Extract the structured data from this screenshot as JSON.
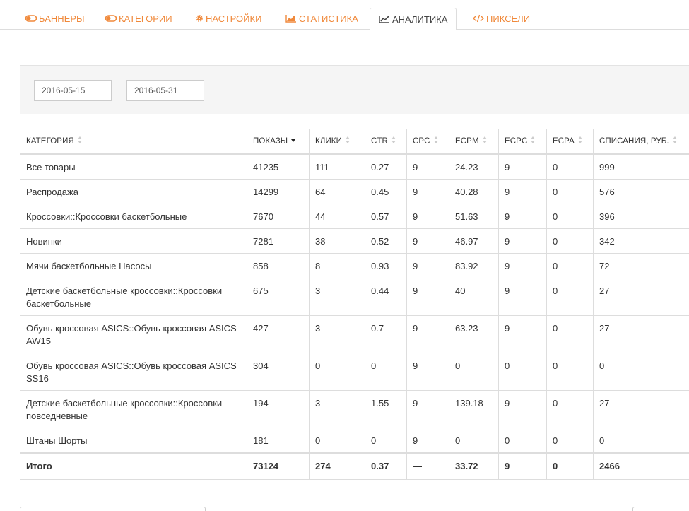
{
  "tabs": [
    {
      "label": "БАННЕРЫ",
      "icon": "toggle-icon"
    },
    {
      "label": "КАТЕГОРИИ",
      "icon": "toggle-icon"
    },
    {
      "label": "НАСТРОЙКИ",
      "icon": "gear-icon"
    },
    {
      "label": "СТАТИСТИКА",
      "icon": "area-chart-icon"
    },
    {
      "label": "АНАЛИТИКА",
      "icon": "line-chart-icon",
      "active": true
    },
    {
      "label": "ПИКСЕЛИ",
      "icon": "code-icon"
    }
  ],
  "filter": {
    "date_from": "2016-05-15",
    "separator": "—",
    "date_to": "2016-05-31"
  },
  "table": {
    "columns": [
      {
        "label": "КАТЕГОРИЯ",
        "sort": "none"
      },
      {
        "label": "ПОКАЗЫ",
        "sort": "desc"
      },
      {
        "label": "КЛИКИ",
        "sort": "none"
      },
      {
        "label": "CTR",
        "sort": "none"
      },
      {
        "label": "CPC",
        "sort": "none"
      },
      {
        "label": "ECPM",
        "sort": "none"
      },
      {
        "label": "ECPC",
        "sort": "none"
      },
      {
        "label": "ECPA",
        "sort": "none"
      },
      {
        "label": "СПИСАНИЯ, РУБ.",
        "sort": "none"
      }
    ],
    "rows": [
      [
        "Все товары",
        "41235",
        "111",
        "0.27",
        "9",
        "24.23",
        "9",
        "0",
        "999"
      ],
      [
        "Распродажа",
        "14299",
        "64",
        "0.45",
        "9",
        "40.28",
        "9",
        "0",
        "576"
      ],
      [
        "Кроссовки::Кроссовки баскетбольные",
        "7670",
        "44",
        "0.57",
        "9",
        "51.63",
        "9",
        "0",
        "396"
      ],
      [
        "Новинки",
        "7281",
        "38",
        "0.52",
        "9",
        "46.97",
        "9",
        "0",
        "342"
      ],
      [
        "Мячи баскетбольные Насосы",
        "858",
        "8",
        "0.93",
        "9",
        "83.92",
        "9",
        "0",
        "72"
      ],
      [
        "Детские баскетбольные кроссовки::Кроссовки баскетбольные",
        "675",
        "3",
        "0.44",
        "9",
        "40",
        "9",
        "0",
        "27"
      ],
      [
        "Обувь кроссовая ASICS::Обувь кроссовая ASICS AW15",
        "427",
        "3",
        "0.7",
        "9",
        "63.23",
        "9",
        "0",
        "27"
      ],
      [
        "Обувь кроссовая ASICS::Обувь кроссовая ASICS SS16",
        "304",
        "0",
        "0",
        "9",
        "0",
        "0",
        "0",
        "0"
      ],
      [
        "Детские баскетбольные кроссовки::Кроссовки повседневные",
        "194",
        "3",
        "1.55",
        "9",
        "139.18",
        "9",
        "0",
        "27"
      ],
      [
        "Штаны Шорты",
        "181",
        "0",
        "0",
        "9",
        "0",
        "0",
        "0",
        "0"
      ]
    ],
    "totals": [
      "Итого",
      "73124",
      "274",
      "0.37",
      "—",
      "33.72",
      "9",
      "0",
      "2466"
    ]
  },
  "colors": {
    "accent": "#f0893b",
    "border": "#dddddd",
    "panel_bg": "#f5f5f5"
  }
}
